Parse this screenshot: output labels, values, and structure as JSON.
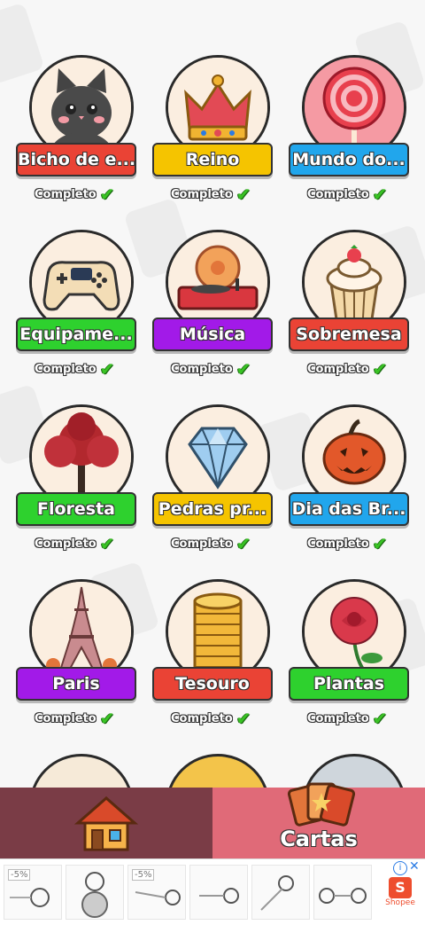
{
  "categories": [
    {
      "label": "Bicho de e...",
      "status": "Completo",
      "color": "#ea4335",
      "art": "cat-icon"
    },
    {
      "label": "Reino",
      "status": "Completo",
      "color": "#f5c400",
      "art": "crown-icon"
    },
    {
      "label": "Mundo do...",
      "status": "Completo",
      "color": "#21a6ec",
      "art": "lollipop-icon"
    },
    {
      "label": "Equipame...",
      "status": "Completo",
      "color": "#2ed12e",
      "art": "gamepad-icon"
    },
    {
      "label": "Música",
      "status": "Completo",
      "color": "#a21ae8",
      "art": "record-player-icon"
    },
    {
      "label": "Sobremesa",
      "status": "Completo",
      "color": "#ea4335",
      "art": "cupcake-icon"
    },
    {
      "label": "Floresta",
      "status": "Completo",
      "color": "#2ed12e",
      "art": "tree-icon"
    },
    {
      "label": "Pedras pr...",
      "status": "Completo",
      "color": "#f5c400",
      "art": "diamond-icon"
    },
    {
      "label": "Dia das Br...",
      "status": "Completo",
      "color": "#21a6ec",
      "art": "pumpkin-icon"
    },
    {
      "label": "Paris",
      "status": "Completo",
      "color": "#a21ae8",
      "art": "eiffel-tower-icon"
    },
    {
      "label": "Tesouro",
      "status": "Completo",
      "color": "#ea4335",
      "art": "coins-icon"
    },
    {
      "label": "Plantas",
      "status": "Completo",
      "color": "#2ed12e",
      "art": "rose-icon"
    }
  ],
  "nav": {
    "home_icon": "house-icon",
    "cards_icon": "cards-icon",
    "cards_label": "Cartas"
  },
  "ad": {
    "badges": [
      "-5%",
      "-5%"
    ],
    "brand": "Shopee",
    "info_icon": "info-icon",
    "close_icon": "close-icon"
  }
}
